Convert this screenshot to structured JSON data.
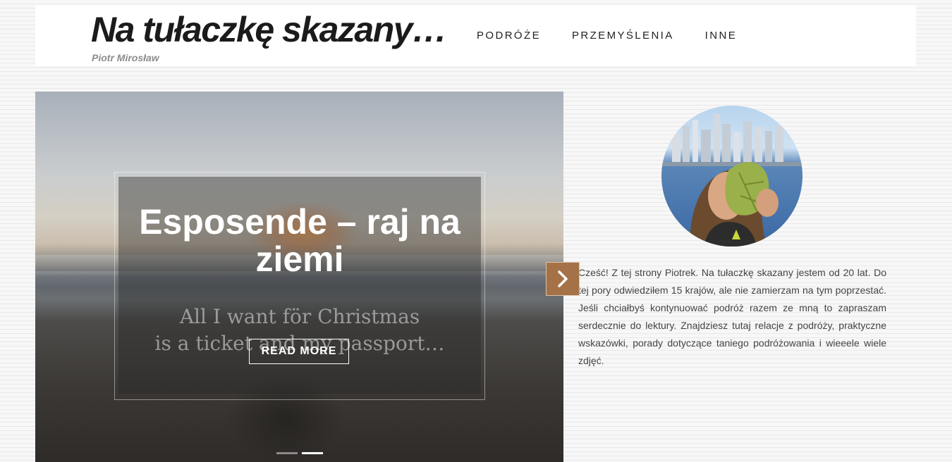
{
  "site": {
    "title": "Na tułaczkę skazany…",
    "subtitle": "Piotr Mirosław"
  },
  "nav": {
    "items": [
      {
        "label": "PODRÓŻE"
      },
      {
        "label": "PRZEMYŚLENIA"
      },
      {
        "label": "INNE"
      }
    ]
  },
  "slider": {
    "title": "Esposende – raj na ziemi",
    "photo_text_line1": "All I want för Christmas",
    "photo_text_line2": "is a ticket and my passport…",
    "read_more_label": "READ MORE",
    "active_slide": 2,
    "total_slides": 2
  },
  "sidebar": {
    "about_text": "Cześć! Z tej strony Piotrek. Na tułaczkę skazany jestem od 20 lat. Do tej pory odwiedziłem 15 krajów, ale nie zamierzam na tym poprzestać. Jeśli chciałbyś kontynuować podróż razem ze mną to zapraszam serdecznie do lektury. Znajdziesz tutaj relacje z podróży, praktyczne wskazówki, porady dotyczące taniego podróżowania i wieeele wiele zdjęć."
  },
  "icons": {
    "next": "chevron-right-icon"
  },
  "colors": {
    "accent": "#a57146"
  }
}
